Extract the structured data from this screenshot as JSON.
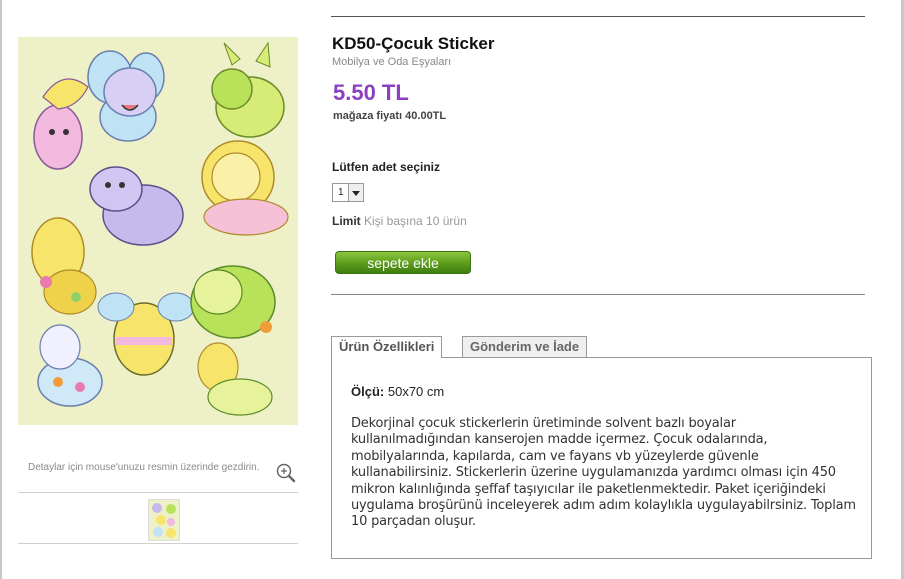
{
  "product": {
    "title": "KD50-Çocuk Sticker",
    "category": "Mobilya ve Oda Eşyaları",
    "price": "5.50 TL",
    "store_price_label": "mağaza fiyatı",
    "store_price_value": "40.00TL"
  },
  "image": {
    "zoom_hint": "Detaylar için mouse'unuzu resmin üzerinde gezdirin.",
    "zoom_icon": "magnifier-plus-icon"
  },
  "order": {
    "quantity_label": "Lütfen adet seçiniz",
    "quantity_value": "1",
    "limit_label": "Limit",
    "limit_value": "Kişi başına 10 ürün",
    "add_to_cart_label": "sepete ekle"
  },
  "tabs": [
    {
      "label": "Ürün  Özellikleri",
      "active": true
    },
    {
      "label": "Gönderim ve İade",
      "active": false
    }
  ],
  "details": {
    "size_label": "Ölçü:",
    "size_value": "50x70 cm",
    "description": "Dekorjinal çocuk stickerlerin üretiminde solvent bazlı boyalar kullanılmadığından kanserojen madde içermez. Çocuk odalarında, mobilyalarında, kapılarda, cam ve fayans vb yüzeylerde güvenle kullanabilirsiniz. Stickerlerin üzerine uygulamanızda yardımcı olması için 450 mikron kalınlığında şeffaf taşıyıcılar ile paketlenmektedir. Paket içeriğindeki uygulama broşürünü inceleyerek adım adım kolaylıkla uygulayabilrsiniz. Toplam 10 parçadan oluşur."
  },
  "colors": {
    "price": "#8c3fc0",
    "button_green": "#5a9b1a",
    "image_background": "#eef1c7"
  }
}
